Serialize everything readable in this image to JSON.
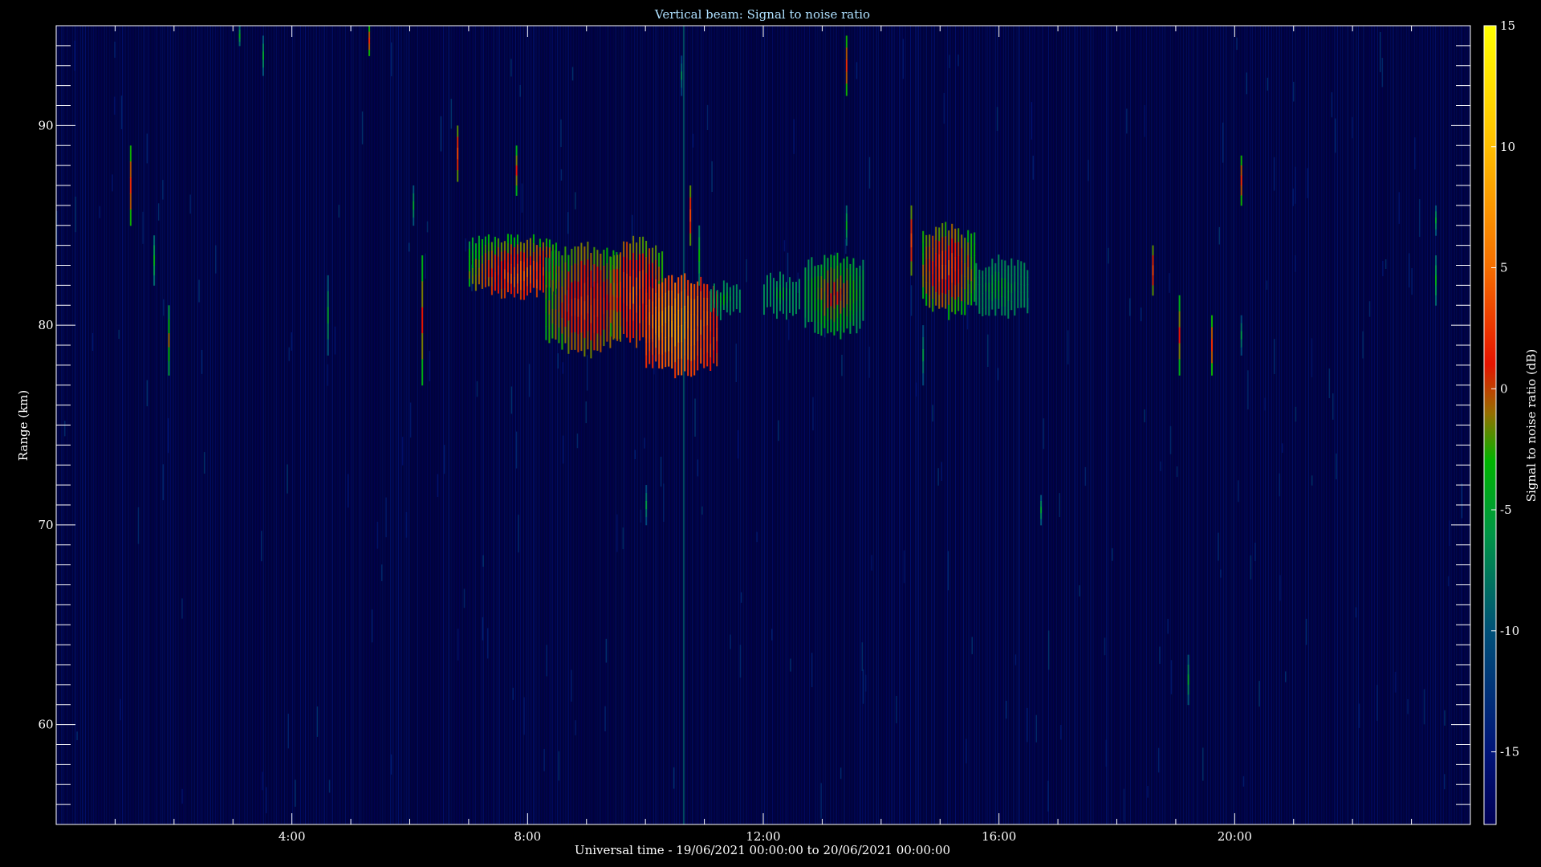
{
  "chart_data": {
    "type": "heatmap",
    "title": "Vertical beam: Signal to noise ratio",
    "xlabel": "Universal time - 19/06/2021 00:00:00 to 20/06/2021 00:00:00",
    "ylabel": "Range (km)",
    "colorbar_label": "Signal to noise ratio (dB)",
    "x_unit": "hours UT",
    "xlim": [
      0,
      24
    ],
    "ylim": [
      55,
      95
    ],
    "zlim": [
      -18,
      15
    ],
    "x_ticks": [
      {
        "value": 4,
        "label": "4:00"
      },
      {
        "value": 8,
        "label": "8:00"
      },
      {
        "value": 12,
        "label": "12:00"
      },
      {
        "value": 16,
        "label": "16:00"
      },
      {
        "value": 20,
        "label": "20:00"
      }
    ],
    "y_ticks": [
      {
        "value": 60,
        "label": "60"
      },
      {
        "value": 70,
        "label": "70"
      },
      {
        "value": 80,
        "label": "80"
      },
      {
        "value": 90,
        "label": "90"
      }
    ],
    "colorbar_ticks": [
      {
        "value": 15,
        "label": "15"
      },
      {
        "value": 10,
        "label": "10"
      },
      {
        "value": 5,
        "label": "5"
      },
      {
        "value": 0,
        "label": "0"
      },
      {
        "value": -5,
        "label": "-5"
      },
      {
        "value": -10,
        "label": "-10"
      },
      {
        "value": -15,
        "label": "-15"
      }
    ],
    "background_snr_db": -17,
    "echo_regions": [
      {
        "t_start": 7.0,
        "t_end": 8.5,
        "r_bottom": 81.5,
        "r_top": 84.5,
        "peak_snr_db": 5,
        "peak_t": 7.9,
        "peak_r": 82.5
      },
      {
        "t_start": 8.3,
        "t_end": 9.6,
        "r_bottom": 78.5,
        "r_top": 84.0,
        "peak_snr_db": 4,
        "peak_t": 9.0,
        "peak_r": 81.0
      },
      {
        "t_start": 9.4,
        "t_end": 10.3,
        "r_bottom": 79.0,
        "r_top": 84.3,
        "peak_snr_db": 5,
        "peak_t": 9.8,
        "peak_r": 81.5
      },
      {
        "t_start": 10.0,
        "t_end": 11.2,
        "r_bottom": 77.5,
        "r_top": 82.5,
        "peak_snr_db": 9,
        "peak_t": 10.5,
        "peak_r": 80.0
      },
      {
        "t_start": 11.1,
        "t_end": 11.6,
        "r_bottom": 80.5,
        "r_top": 82.0,
        "peak_snr_db": -3,
        "peak_t": 11.3,
        "peak_r": 81.3
      },
      {
        "t_start": 12.0,
        "t_end": 12.6,
        "r_bottom": 80.5,
        "r_top": 82.5,
        "peak_snr_db": -4,
        "peak_t": 12.3,
        "peak_r": 81.5
      },
      {
        "t_start": 12.7,
        "t_end": 13.7,
        "r_bottom": 79.5,
        "r_top": 83.5,
        "peak_snr_db": 1,
        "peak_t": 13.2,
        "peak_r": 81.5
      },
      {
        "t_start": 14.7,
        "t_end": 15.6,
        "r_bottom": 80.5,
        "r_top": 85.0,
        "peak_snr_db": 4,
        "peak_t": 15.1,
        "peak_r": 82.8
      },
      {
        "t_start": 15.6,
        "t_end": 16.5,
        "r_bottom": 80.5,
        "r_top": 83.3,
        "peak_snr_db": -3,
        "peak_t": 16.0,
        "peak_r": 81.8
      }
    ],
    "isolated_spikes": [
      {
        "t": 1.25,
        "r_bottom": 85.0,
        "r_top": 89.0,
        "peak_snr_db": 2
      },
      {
        "t": 1.65,
        "r_bottom": 82.0,
        "r_top": 84.5,
        "peak_snr_db": -4
      },
      {
        "t": 1.9,
        "r_bottom": 77.5,
        "r_top": 81.0,
        "peak_snr_db": -1
      },
      {
        "t": 3.1,
        "r_bottom": 94.0,
        "r_top": 95.0,
        "peak_snr_db": -4
      },
      {
        "t": 3.5,
        "r_bottom": 92.5,
        "r_top": 94.5,
        "peak_snr_db": -5
      },
      {
        "t": 4.6,
        "r_bottom": 78.5,
        "r_top": 82.5,
        "peak_snr_db": -5
      },
      {
        "t": 5.3,
        "r_bottom": 93.5,
        "r_top": 95.0,
        "peak_snr_db": 2
      },
      {
        "t": 6.05,
        "r_bottom": 85.0,
        "r_top": 87.0,
        "peak_snr_db": -5
      },
      {
        "t": 6.2,
        "r_bottom": 77.0,
        "r_top": 83.5,
        "peak_snr_db": 1
      },
      {
        "t": 6.8,
        "r_bottom": 87.2,
        "r_top": 90.0,
        "peak_snr_db": 3
      },
      {
        "t": 7.8,
        "r_bottom": 86.5,
        "r_top": 89.0,
        "peak_snr_db": 1
      },
      {
        "t": 10.0,
        "r_bottom": 70.0,
        "r_top": 72.0,
        "peak_snr_db": -6
      },
      {
        "t": 10.6,
        "r_bottom": 91.5,
        "r_top": 93.5,
        "peak_snr_db": -7
      },
      {
        "t": 10.75,
        "r_bottom": 84.0,
        "r_top": 87.0,
        "peak_snr_db": 3
      },
      {
        "t": 10.9,
        "r_bottom": 82.0,
        "r_top": 85.0,
        "peak_snr_db": -3
      },
      {
        "t": 13.4,
        "r_bottom": 91.5,
        "r_top": 94.5,
        "peak_snr_db": 2
      },
      {
        "t": 13.4,
        "r_bottom": 84.0,
        "r_top": 86.0,
        "peak_snr_db": -4
      },
      {
        "t": 14.5,
        "r_bottom": 82.5,
        "r_top": 86.0,
        "peak_snr_db": 3
      },
      {
        "t": 14.7,
        "r_bottom": 77.0,
        "r_top": 80.0,
        "peak_snr_db": -6
      },
      {
        "t": 16.7,
        "r_bottom": 70.0,
        "r_top": 71.5,
        "peak_snr_db": -5
      },
      {
        "t": 18.6,
        "r_bottom": 81.5,
        "r_top": 84.0,
        "peak_snr_db": 3
      },
      {
        "t": 19.05,
        "r_bottom": 77.5,
        "r_top": 81.5,
        "peak_snr_db": 1
      },
      {
        "t": 19.2,
        "r_bottom": 61.0,
        "r_top": 63.5,
        "peak_snr_db": -5
      },
      {
        "t": 19.6,
        "r_bottom": 77.5,
        "r_top": 80.5,
        "peak_snr_db": 2
      },
      {
        "t": 20.1,
        "r_bottom": 86.0,
        "r_top": 88.5,
        "peak_snr_db": 2
      },
      {
        "t": 20.1,
        "r_bottom": 78.5,
        "r_top": 80.5,
        "peak_snr_db": -6
      },
      {
        "t": 23.4,
        "r_bottom": 81.0,
        "r_top": 83.5,
        "peak_snr_db": -4
      },
      {
        "t": 23.4,
        "r_bottom": 84.5,
        "r_top": 86.0,
        "peak_snr_db": -5
      }
    ],
    "persistent_vertical_line": {
      "t": 10.65,
      "snr_db": -9
    }
  }
}
